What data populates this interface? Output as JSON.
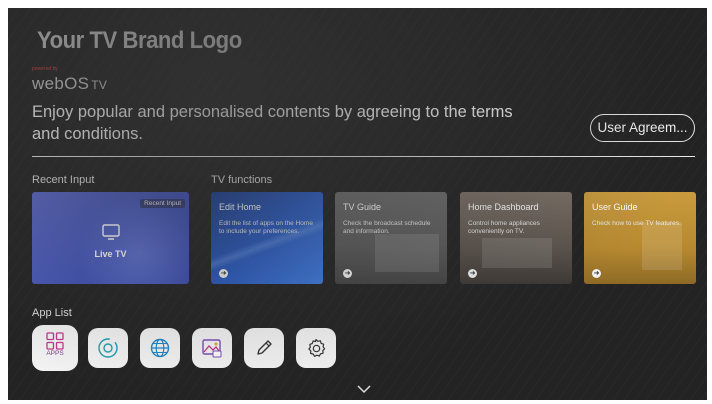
{
  "header": {
    "brand_logo": "Your TV Brand Logo",
    "powered_by": "powered by",
    "platform_logo": "webOS",
    "platform_suffix": "TV"
  },
  "terms": {
    "message": "Enjoy popular and personalised contents by agreeing to the terms and conditions.",
    "agree_button": "User Agreem..."
  },
  "recent_input": {
    "section_label": "Recent Input",
    "badge": "Recent Input",
    "card_label": "Live TV",
    "icon": "tv-icon",
    "color": "#4a5ac0"
  },
  "tv_functions": {
    "section_label": "TV functions",
    "cards": [
      {
        "title": "Edit Home",
        "description": "Edit the list of apps on the Home to include your preferences.",
        "color": "#2a5bc2"
      },
      {
        "title": "TV Guide",
        "description": "Check the broadcast schedule and information.",
        "color": "#5f5f5f"
      },
      {
        "title": "Home Dashboard",
        "description": "Control home appliances conveniently on TV.",
        "color": "#5c544d"
      },
      {
        "title": "User Guide",
        "description": "Check how to use TV features.",
        "color": "#b88a30"
      }
    ]
  },
  "app_list": {
    "section_label": "App List",
    "items": [
      {
        "label": "APPS",
        "icon": "apps-grid-icon"
      },
      {
        "icon": "home-dashboard-icon"
      },
      {
        "icon": "web-browser-icon"
      },
      {
        "icon": "gallery-icon"
      },
      {
        "icon": "edit-pencil-icon"
      },
      {
        "icon": "settings-gear-icon"
      }
    ]
  },
  "footer": {
    "icon": "chevron-down-icon"
  }
}
